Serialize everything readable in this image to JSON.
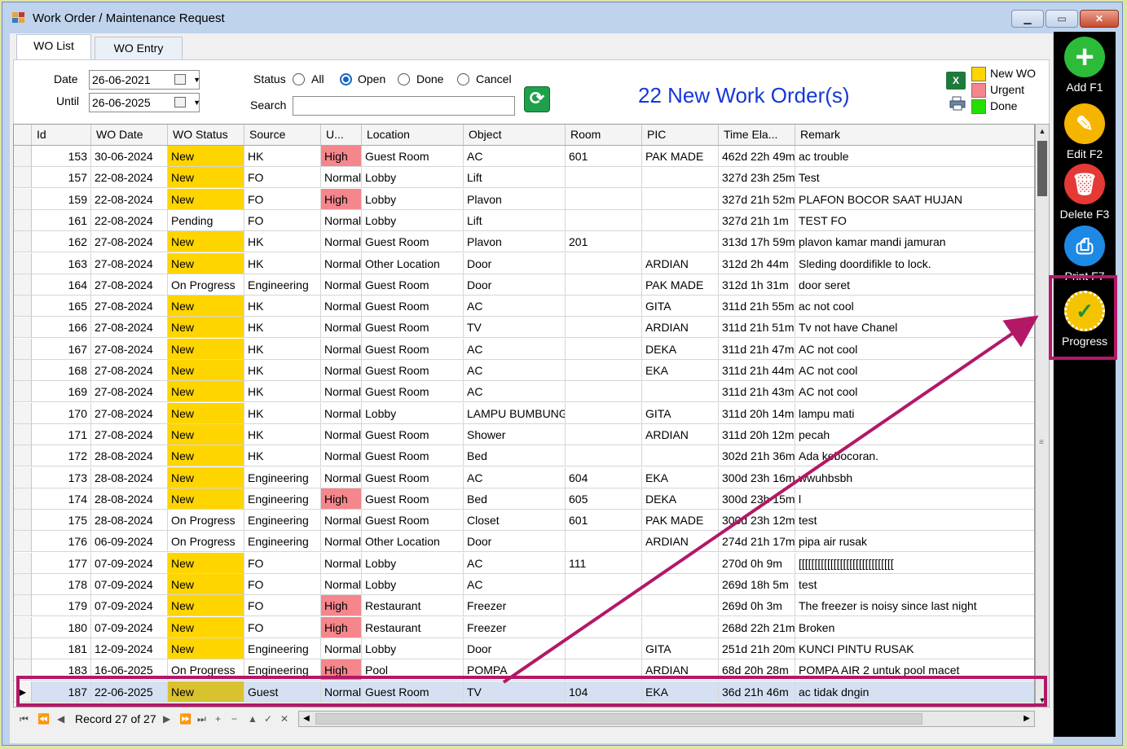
{
  "window": {
    "title": "Work Order / Maintenance Request",
    "controls": [
      "minimize",
      "maximize",
      "close"
    ]
  },
  "tabs": [
    {
      "label": "WO List",
      "active": true
    },
    {
      "label": "WO Entry",
      "active": false
    }
  ],
  "filters": {
    "date_label": "Date",
    "date_value": "26-06-2021",
    "until_label": "Until",
    "until_value": "26-06-2025",
    "status_label": "Status",
    "status_options": [
      {
        "label": "All",
        "selected": false
      },
      {
        "label": "Open",
        "selected": true
      },
      {
        "label": "Done",
        "selected": false
      },
      {
        "label": "Cancel",
        "selected": false
      }
    ],
    "search_label": "Search",
    "search_value": ""
  },
  "new_work_orders_text": "22 New Work Order(s)",
  "legend": [
    {
      "label": "New WO",
      "color": "#ffd500"
    },
    {
      "label": "Urgent",
      "color": "#f4868c"
    },
    {
      "label": "Done",
      "color": "#22e000"
    }
  ],
  "colors": {
    "status_new": "#ffd500",
    "status_new_selected": "#d9c230",
    "urgent_high": "#f4868c",
    "title_blue": "#1538d6",
    "annotation": "#b31867"
  },
  "grid": {
    "columns": [
      "Id",
      "WO Date",
      "WO Status",
      "Source",
      "U...",
      "Location",
      "Object",
      "Room",
      "PIC",
      "Time Ela...",
      "Remark"
    ],
    "rows": [
      {
        "id": "153",
        "date": "30-06-2024",
        "status": "New",
        "source": "HK",
        "urgency": "High",
        "location": "Guest Room",
        "object": "AC",
        "room": "601",
        "pic": "PAK MADE",
        "elapsed": "462d 22h 49m",
        "remark": "ac trouble"
      },
      {
        "id": "157",
        "date": "22-08-2024",
        "status": "New",
        "source": "FO",
        "urgency": "Normal",
        "location": "Lobby",
        "object": "Lift",
        "room": "",
        "pic": "",
        "elapsed": "327d 23h 25m",
        "remark": "Test"
      },
      {
        "id": "159",
        "date": "22-08-2024",
        "status": "New",
        "source": "FO",
        "urgency": "High",
        "location": "Lobby",
        "object": "Plavon",
        "room": "",
        "pic": "",
        "elapsed": "327d 21h 52m",
        "remark": "PLAFON BOCOR SAAT HUJAN"
      },
      {
        "id": "161",
        "date": "22-08-2024",
        "status": "Pending",
        "source": "FO",
        "urgency": "Normal",
        "location": "Lobby",
        "object": "Lift",
        "room": "",
        "pic": "",
        "elapsed": "327d 21h 1m",
        "remark": "TEST FO"
      },
      {
        "id": "162",
        "date": "27-08-2024",
        "status": "New",
        "source": "HK",
        "urgency": "Normal",
        "location": "Guest Room",
        "object": "Plavon",
        "room": "201",
        "pic": "",
        "elapsed": "313d 17h 59m",
        "remark": "plavon kamar mandi jamuran"
      },
      {
        "id": "163",
        "date": "27-08-2024",
        "status": "New",
        "source": "HK",
        "urgency": "Normal",
        "location": "Other Location",
        "object": "Door",
        "room": "",
        "pic": "ARDIAN",
        "elapsed": "312d 2h 44m",
        "remark": "Sleding doordifikle to lock."
      },
      {
        "id": "164",
        "date": "27-08-2024",
        "status": "On Progress",
        "source": "Engineering",
        "urgency": "Normal",
        "location": "Guest Room",
        "object": "Door",
        "room": "",
        "pic": "PAK MADE",
        "elapsed": "312d 1h 31m",
        "remark": "door seret"
      },
      {
        "id": "165",
        "date": "27-08-2024",
        "status": "New",
        "source": "HK",
        "urgency": "Normal",
        "location": "Guest Room",
        "object": "AC",
        "room": "",
        "pic": "GITA",
        "elapsed": "311d 21h 55m",
        "remark": "ac not cool"
      },
      {
        "id": "166",
        "date": "27-08-2024",
        "status": "New",
        "source": "HK",
        "urgency": "Normal",
        "location": "Guest Room",
        "object": "TV",
        "room": "",
        "pic": "ARDIAN",
        "elapsed": "311d 21h 51m",
        "remark": "Tv not have Chanel"
      },
      {
        "id": "167",
        "date": "27-08-2024",
        "status": "New",
        "source": "HK",
        "urgency": "Normal",
        "location": "Guest Room",
        "object": "AC",
        "room": "",
        "pic": "DEKA",
        "elapsed": "311d 21h 47m",
        "remark": "AC not cool"
      },
      {
        "id": "168",
        "date": "27-08-2024",
        "status": "New",
        "source": "HK",
        "urgency": "Normal",
        "location": "Guest Room",
        "object": "AC",
        "room": "",
        "pic": "EKA",
        "elapsed": "311d 21h 44m",
        "remark": "AC not cool"
      },
      {
        "id": "169",
        "date": "27-08-2024",
        "status": "New",
        "source": "HK",
        "urgency": "Normal",
        "location": "Guest Room",
        "object": "AC",
        "room": "",
        "pic": "",
        "elapsed": "311d 21h 43m",
        "remark": "AC not cool"
      },
      {
        "id": "170",
        "date": "27-08-2024",
        "status": "New",
        "source": "HK",
        "urgency": "Normal",
        "location": "Lobby",
        "object": "LAMPU BUMBUNG",
        "room": "",
        "pic": "GITA",
        "elapsed": "311d 20h 14m",
        "remark": "lampu mati"
      },
      {
        "id": "171",
        "date": "27-08-2024",
        "status": "New",
        "source": "HK",
        "urgency": "Normal",
        "location": "Guest Room",
        "object": "Shower",
        "room": "",
        "pic": "ARDIAN",
        "elapsed": "311d 20h 12m",
        "remark": "pecah"
      },
      {
        "id": "172",
        "date": "28-08-2024",
        "status": "New",
        "source": "HK",
        "urgency": "Normal",
        "location": "Guest Room",
        "object": "Bed",
        "room": "",
        "pic": "",
        "elapsed": "302d 21h 36m",
        "remark": "Ada kebocoran."
      },
      {
        "id": "173",
        "date": "28-08-2024",
        "status": "New",
        "source": "Engineering",
        "urgency": "Normal",
        "location": "Guest Room",
        "object": "AC",
        "room": "604",
        "pic": "EKA",
        "elapsed": "300d 23h 16m",
        "remark": "wwuhbsbh"
      },
      {
        "id": "174",
        "date": "28-08-2024",
        "status": "New",
        "source": "Engineering",
        "urgency": "High",
        "location": "Guest Room",
        "object": "Bed",
        "room": "605",
        "pic": "DEKA",
        "elapsed": "300d 23h 15m",
        "remark": "l"
      },
      {
        "id": "175",
        "date": "28-08-2024",
        "status": "On Progress",
        "source": "Engineering",
        "urgency": "Normal",
        "location": "Guest Room",
        "object": "Closet",
        "room": "601",
        "pic": "PAK MADE",
        "elapsed": "300d 23h 12m",
        "remark": "test"
      },
      {
        "id": "176",
        "date": "06-09-2024",
        "status": "On Progress",
        "source": "Engineering",
        "urgency": "Normal",
        "location": "Other Location",
        "object": "Door",
        "room": "",
        "pic": "ARDIAN",
        "elapsed": "274d 21h 17m",
        "remark": "pipa air rusak"
      },
      {
        "id": "177",
        "date": "07-09-2024",
        "status": "New",
        "source": "FO",
        "urgency": "Normal",
        "location": "Lobby",
        "object": "AC",
        "room": "111",
        "pic": "",
        "elapsed": "270d 0h 9m",
        "remark": "[[[[[[[[[[[[[[[[[[[[[[[[[[[[[["
      },
      {
        "id": "178",
        "date": "07-09-2024",
        "status": "New",
        "source": "FO",
        "urgency": "Normal",
        "location": "Lobby",
        "object": "AC",
        "room": "",
        "pic": "",
        "elapsed": "269d 18h 5m",
        "remark": "test"
      },
      {
        "id": "179",
        "date": "07-09-2024",
        "status": "New",
        "source": "FO",
        "urgency": "High",
        "location": "Restaurant",
        "object": "Freezer",
        "room": "",
        "pic": "",
        "elapsed": "269d 0h 3m",
        "remark": "The freezer is noisy since last night"
      },
      {
        "id": "180",
        "date": "07-09-2024",
        "status": "New",
        "source": "FO",
        "urgency": "High",
        "location": "Restaurant",
        "object": "Freezer",
        "room": "",
        "pic": "",
        "elapsed": "268d 22h 21m",
        "remark": "Broken"
      },
      {
        "id": "181",
        "date": "12-09-2024",
        "status": "New",
        "source": "Engineering",
        "urgency": "Normal",
        "location": "Lobby",
        "object": "Door",
        "room": "",
        "pic": "GITA",
        "elapsed": "251d 21h 20m",
        "remark": "KUNCI PINTU RUSAK"
      },
      {
        "id": "183",
        "date": "16-06-2025",
        "status": "On Progress",
        "source": "Engineering",
        "urgency": "High",
        "location": "Pool",
        "object": "POMPA",
        "room": "",
        "pic": "ARDIAN",
        "elapsed": "68d 20h 28m",
        "remark": "POMPA AIR 2 untuk pool macet"
      },
      {
        "id": "187",
        "date": "22-06-2025",
        "status": "New",
        "source": "Guest",
        "urgency": "Normal",
        "location": "Guest Room",
        "object": "TV",
        "room": "104",
        "pic": "EKA",
        "elapsed": "36d 21h 46m",
        "remark": "ac tidak dngin",
        "selected": true
      }
    ]
  },
  "navigator": {
    "record_text": "Record 27 of 27"
  },
  "toolbar": [
    {
      "label": "Add F1",
      "icon": "plus-icon",
      "color": "#2dbb3a",
      "glyph": "+"
    },
    {
      "label": "Edit F2",
      "icon": "edit-icon",
      "color": "#f5b400",
      "glyph": "✎"
    },
    {
      "label": "Delete F3",
      "icon": "trash-icon",
      "color": "#e53935",
      "glyph": "🗑"
    },
    {
      "label": "Print F7",
      "icon": "printer-icon",
      "color": "#1e88e5",
      "glyph": "⎙"
    },
    {
      "label": "Progress",
      "icon": "progress-check-icon",
      "color": "#f5c400",
      "glyph": "✓"
    }
  ]
}
